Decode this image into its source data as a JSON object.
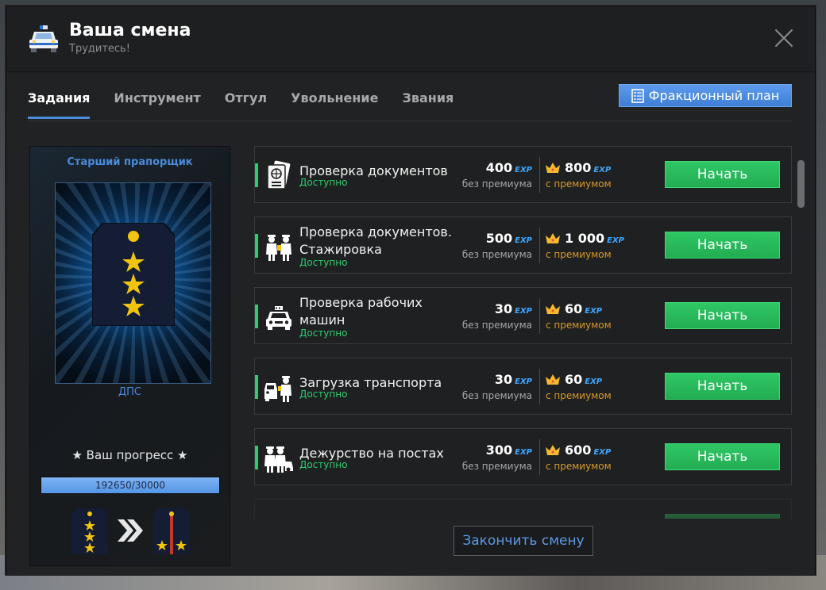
{
  "window": {
    "title": "Ваша смена",
    "subtitle": "Трудитесь!"
  },
  "tabs": [
    {
      "label": "Задания",
      "active": true
    },
    {
      "label": "Инструмент",
      "active": false
    },
    {
      "label": "Отгул",
      "active": false
    },
    {
      "label": "Увольнение",
      "active": false
    },
    {
      "label": "Звания",
      "active": false
    }
  ],
  "plan_button": {
    "label": "Фракционный план",
    "icon": "checklist-icon"
  },
  "rank_card": {
    "rank_name": "Старший прапорщик",
    "unit": "ДПС",
    "progress_label": "★ Ваш прогресс ★",
    "progress_text": "192650/30000",
    "progress_fraction": 1.0
  },
  "tasks": [
    {
      "name": "Проверка документов",
      "status": "Доступно",
      "base_exp": "400",
      "premium_exp": "800",
      "icon": "passport-icon",
      "two_line": false
    },
    {
      "name": "Проверка документов. Стажировка",
      "status": "Доступно",
      "base_exp": "500",
      "premium_exp": "1 000",
      "icon": "officers-icon",
      "two_line": true
    },
    {
      "name": "Проверка рабочих машин",
      "status": "Доступно",
      "base_exp": "30",
      "premium_exp": "60",
      "icon": "taxi-car-icon",
      "two_line": true
    },
    {
      "name": "Загрузка транспорта",
      "status": "Доступно",
      "base_exp": "30",
      "premium_exp": "60",
      "icon": "officer-car-icon",
      "two_line": false
    },
    {
      "name": "Дежурство на постах",
      "status": "Доступно",
      "base_exp": "300",
      "premium_exp": "600",
      "icon": "post-duty-icon",
      "two_line": false
    }
  ],
  "labels": {
    "exp": "EXP",
    "no_premium": "без премиума",
    "with_premium": "с премиумом",
    "start": "Начать"
  },
  "end_button": {
    "label": "Закончить смену"
  },
  "colors": {
    "accent_blue": "#4a8bdb",
    "green": "#2ecc71",
    "premium_gold": "#d79a2b"
  }
}
